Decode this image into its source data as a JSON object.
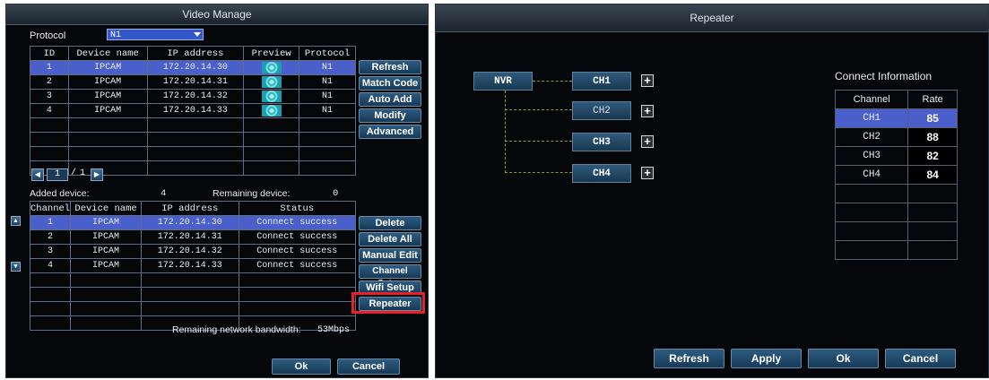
{
  "left": {
    "title": "Video Manage",
    "protocol_label": "Protocol",
    "protocol_value": "N1",
    "search_table": {
      "headers": [
        "ID",
        "Device name",
        "IP address",
        "Preview",
        "Protocol"
      ],
      "rows": [
        [
          "1",
          "IPCAM",
          "172.20.14.30",
          "N1"
        ],
        [
          "2",
          "IPCAM",
          "172.20.14.31",
          "N1"
        ],
        [
          "3",
          "IPCAM",
          "172.20.14.32",
          "N1"
        ],
        [
          "4",
          "IPCAM",
          "172.20.14.33",
          "N1"
        ]
      ]
    },
    "side_buttons_top": [
      "Refresh",
      "Match Code",
      "Auto Add",
      "Modify",
      "Advanced"
    ],
    "pager": {
      "current": "1",
      "sep": "/",
      "total": "1"
    },
    "added_label": "Added device:",
    "added_value": "4",
    "remaining_label": "Remaining device:",
    "remaining_value": "0",
    "added_table": {
      "headers": [
        "Channel",
        "Device name",
        "IP address",
        "Status"
      ],
      "rows": [
        [
          "1",
          "IPCAM",
          "172.20.14.30",
          "Connect success"
        ],
        [
          "2",
          "IPCAM",
          "172.20.14.31",
          "Connect success"
        ],
        [
          "3",
          "IPCAM",
          "172.20.14.32",
          "Connect success"
        ],
        [
          "4",
          "IPCAM",
          "172.20.14.33",
          "Connect success"
        ]
      ]
    },
    "side_buttons_bottom": [
      "Delete",
      "Delete All",
      "Manual Edit",
      "Channel Setup",
      "Wifi Setup",
      "Repeater"
    ],
    "bandwidth_label": "Remaining network bandwidth:",
    "bandwidth_value": "53Mbps",
    "ok": "Ok",
    "cancel": "Cancel",
    "highlight_color": "#e8202a"
  },
  "right": {
    "title": "Repeater",
    "nvr": "NVR",
    "channels": [
      "CH1",
      "CH2",
      "CH3",
      "CH4"
    ],
    "connect_title": "Connect Information",
    "ci_headers": [
      "Channel",
      "Rate"
    ],
    "ci_rows": [
      [
        "CH1",
        "85"
      ],
      [
        "CH2",
        "88"
      ],
      [
        "CH3",
        "82"
      ],
      [
        "CH4",
        "84"
      ]
    ],
    "buttons": [
      "Refresh",
      "Apply",
      "Ok",
      "Cancel"
    ]
  }
}
